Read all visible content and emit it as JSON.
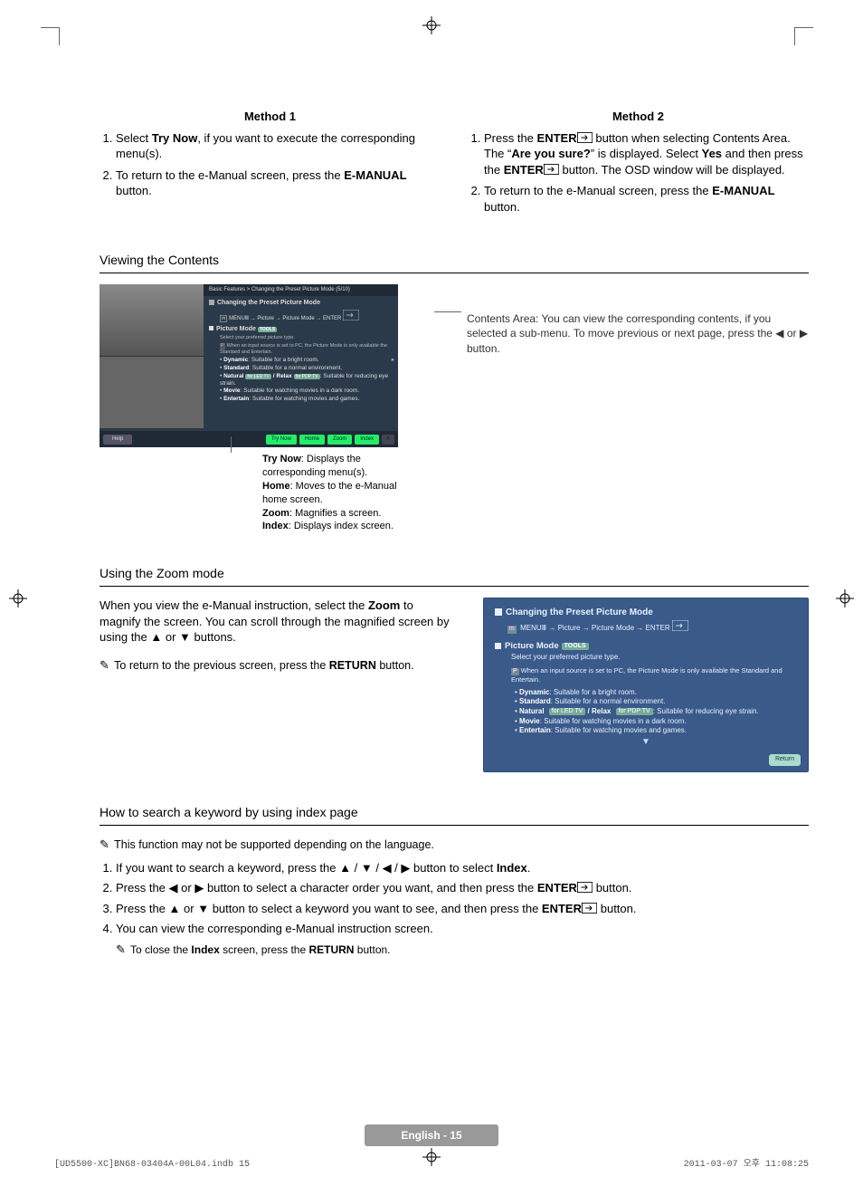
{
  "methods": {
    "m1": {
      "title": "Method 1",
      "steps": [
        {
          "pre": "Select ",
          "bold": "Try Now",
          "post": ", if you want to execute the corresponding menu(s)."
        },
        {
          "pre": "To return to the e-Manual screen, press the ",
          "bold": "E-MANUAL",
          "post": " button."
        }
      ]
    },
    "m2": {
      "title": "Method 2",
      "steps": [
        {
          "segments": [
            {
              "t": "Press the "
            },
            {
              "b": "ENTER"
            },
            {
              "icon": "enter"
            },
            {
              "t": " button when selecting Contents Area. The “"
            },
            {
              "b": "Are you sure?"
            },
            {
              "t": "” is displayed. Select "
            },
            {
              "b": "Yes"
            },
            {
              "t": " and then press the "
            },
            {
              "b": "ENTER"
            },
            {
              "icon": "enter"
            },
            {
              "t": " button. The OSD window will be displayed."
            }
          ]
        },
        {
          "segments": [
            {
              "t": "To return to the e-Manual screen, press the "
            },
            {
              "b": "E-MANUAL"
            },
            {
              "t": " button."
            }
          ]
        }
      ]
    }
  },
  "viewing": {
    "heading": "Viewing the Contents",
    "callout": "Contents Area: You can view the corresponding contents, if you selected a sub-menu. To move previous or next page, press the ◀ or ▶ button.",
    "panel": {
      "breadcrumb": "Basic Features > Changing the Preset Picture Mode (5/10)",
      "head1": "Changing the Preset Picture Mode",
      "path_pre": "MENU",
      "path_arrow": " → Picture → Picture Mode → ENTER",
      "head2": "Picture Mode",
      "tools_tag": "TOOLS",
      "line_select": "Select your preferred picture type.",
      "note_pc": "When an input source is set to PC, the Picture Mode is only available the Standard and Entertain.",
      "bullets": [
        {
          "b": "Dynamic",
          "t": ": Suitable for a bright room."
        },
        {
          "b": "Standard",
          "t": ": Suitable for a normal environment."
        },
        {
          "b": "Natural",
          "tag": "for LED TV",
          "b2": " / Relax",
          "tag2": "for PDP TV",
          "t": ": Suitable for reducing eye strain."
        },
        {
          "b": "Movie",
          "t": ": Suitable for watching movies in a dark room."
        },
        {
          "b": "Entertain",
          "t": ": Suitable for watching movies and games."
        }
      ],
      "footer": {
        "help": "Help",
        "btns": [
          "Try Now",
          "Home",
          "Zoom",
          "Index"
        ],
        "close": "X"
      }
    },
    "caption": {
      "trynow_b": "Try Now",
      "trynow_t": ": Displays the corresponding menu(s).",
      "home_b": "Home",
      "home_t": ": Moves to the e-Manual home screen.",
      "zoom_b": "Zoom",
      "zoom_t": ": Magnifies a screen.",
      "index_b": "Index",
      "index_t": ": Displays index screen."
    }
  },
  "zoom": {
    "heading": "Using the Zoom mode",
    "para_pre": "When you view the e-Manual instruction, select the ",
    "para_b": "Zoom",
    "para_mid": " to magnify the screen. You can scroll through the magnified screen by using the ",
    "para_post": " buttons.",
    "note": "To return to the previous screen, press the RETURN button.",
    "note_pre": "To return to the previous screen, press the ",
    "note_b": "RETURN",
    "note_post": " button.",
    "panel": {
      "head": "Changing the Preset Picture Mode",
      "path": " → Picture → Picture Mode → ENTER",
      "sub": "Picture Mode",
      "tools_tag": "TOOLS",
      "line_select": "Select your preferred picture type.",
      "note_pc_pre": "When an input source is set to PC, the ",
      "note_pc_b1": "Picture Mode",
      "note_pc_mid": " is only available the ",
      "note_pc_b2": "Standard",
      "note_pc_and": " and ",
      "note_pc_b3": "Entertain",
      "note_pc_post": ".",
      "bullets": [
        {
          "b": "Dynamic",
          "t": ": Suitable for a bright room."
        },
        {
          "b": "Standard",
          "t": ": Suitable for a normal environment."
        },
        {
          "b": "Natural",
          "tag": "for LED TV",
          "b2": " / Relax ",
          "tag2": "for PDP TV",
          "t": ": Suitable for reducing eye strain."
        },
        {
          "b": "Movie",
          "t": ": Suitable for watching movies in a dark room."
        },
        {
          "b": "Entertain",
          "t": ": Suitable for watching movies and games."
        }
      ],
      "return": "Return"
    }
  },
  "index": {
    "heading": "How to search a keyword by using index page",
    "note": "This function may not be supported depending on the language.",
    "steps": [
      {
        "segments": [
          {
            "t": "If you want to search a keyword, press the "
          },
          {
            "icon": "up"
          },
          {
            "t": " / "
          },
          {
            "icon": "down"
          },
          {
            "t": " / "
          },
          {
            "icon": "left"
          },
          {
            "t": " / "
          },
          {
            "icon": "right"
          },
          {
            "t": " button to select "
          },
          {
            "b": "Index"
          },
          {
            "t": "."
          }
        ]
      },
      {
        "segments": [
          {
            "t": "Press the "
          },
          {
            "icon": "left"
          },
          {
            "t": " or "
          },
          {
            "icon": "right"
          },
          {
            "t": " button to select a character order you want, and then press the "
          },
          {
            "b": "ENTER"
          },
          {
            "icon": "enter"
          },
          {
            "t": " button."
          }
        ]
      },
      {
        "segments": [
          {
            "t": "Press the "
          },
          {
            "icon": "up"
          },
          {
            "t": " or "
          },
          {
            "icon": "down"
          },
          {
            "t": " button to select a keyword you want to see, and then press the "
          },
          {
            "b": "ENTER"
          },
          {
            "icon": "enter"
          },
          {
            "t": " button."
          }
        ]
      },
      {
        "segments": [
          {
            "t": "You can view the corresponding e-Manual instruction screen."
          }
        ]
      }
    ],
    "subnote_pre": "To close the ",
    "subnote_b": "Index",
    "subnote_mid": " screen, press the ",
    "subnote_b2": "RETURN",
    "subnote_post": " button."
  },
  "footer": {
    "page_label": "English - 15",
    "imprint_left": "[UD5500-XC]BN68-03404A-00L04.indb   15",
    "imprint_right": "2011-03-07   오후 11:08:25"
  }
}
